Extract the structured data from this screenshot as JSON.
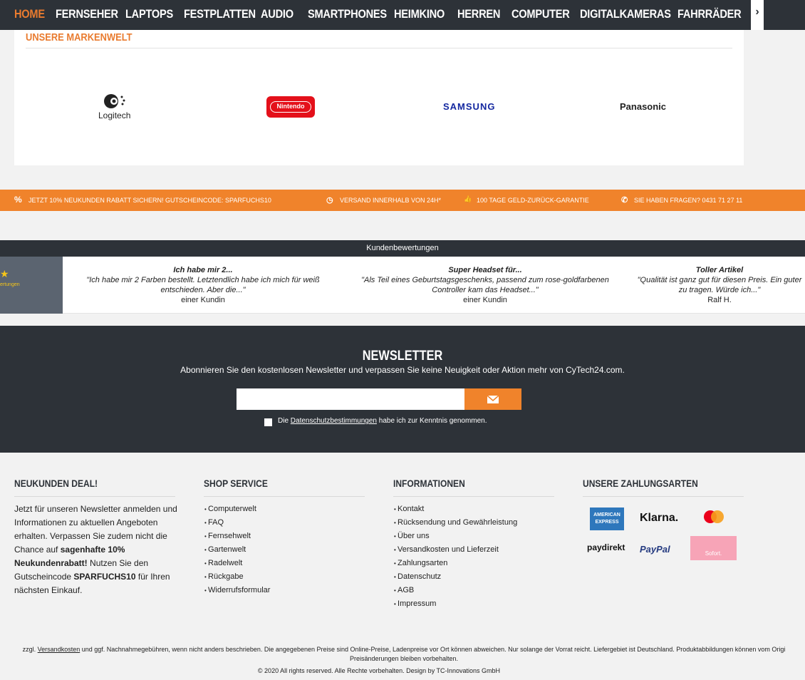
{
  "nav": {
    "items": [
      "HOME",
      "FERNSEHER",
      "LAPTOPS",
      "FESTPLATTEN",
      "AUDIO",
      "SMARTPHONES",
      "HEIMKINO",
      "HERREN",
      "COMPUTER",
      "DIGITALKAMERAS",
      "FAHRRÄDER"
    ],
    "active": "HOME",
    "arrow": "›"
  },
  "brands": {
    "title": "UNSERE MARKENWELT",
    "logitech": "Logitech",
    "nintendo": "Nintendo",
    "samsung": "SAMSUNG",
    "panasonic": "Panasonic"
  },
  "promo": {
    "rabatt": "JETZT 10% NEUKUNDEN RABATT SICHERN! GUTSCHEINCODE: SPARFUCHS10",
    "versand": "VERSAND INNERHALB VON 24H*",
    "garantie": "100 TAGE GELD-ZURÜCK-GARANTIE",
    "fragen": "SIE HABEN FRAGEN? 0431 71 27 11",
    "icon_percent": "%",
    "icon_clock": "◷",
    "icon_thumb": "👍",
    "icon_phone": "✆"
  },
  "reviews": {
    "header": "Kundenbewertungen",
    "badge_text": "ertungen",
    "items": [
      {
        "title": "Ich habe mir 2...",
        "text": "\"Ich habe mir 2 Farben bestellt. Letztendlich habe ich mich für weiß entschieden. Aber die...\"",
        "author": "einer Kundin"
      },
      {
        "title": "Super Headset für...",
        "text": "\"Als Teil eines Geburtstagsgeschenks, passend zum rose-goldfarbenen Controller kam das Headset...\"",
        "author": "einer Kundin"
      },
      {
        "title": "Toller Artikel",
        "text": "\"Qualität ist ganz gut für diesen Preis. Ein guter zu tragen. Würde ich...\"",
        "author": "Ralf H."
      }
    ]
  },
  "newsletter": {
    "title": "NEWSLETTER",
    "subtitle": "Abonnieren Sie den kostenlosen Newsletter und verpassen Sie keine Neuigkeit oder Aktion mehr von CyTech24.com.",
    "input_value": "",
    "consent_prefix": "Die",
    "consent_link": "Datenschutzbestimmungen",
    "consent_suffix": "habe ich zur Kenntnis genommen."
  },
  "footer": {
    "deal": {
      "title": "NEUKUNDEN DEAL!",
      "text_1": "Jetzt für unseren Newsletter anmelden und Informationen zu aktuellen Angeboten erhalten. Verpassen Sie zudem nicht die Chance auf ",
      "bold_1": "sagenhafte 10% Neukundenrabatt!",
      "text_2": " Nutzen Sie den Gutscheincode ",
      "bold_2": "SPARFUCHS10",
      "text_3": " für Ihren nächsten Einkauf."
    },
    "service": {
      "title": "SHOP SERVICE",
      "items": [
        "Computerwelt",
        "FAQ",
        "Fernsehwelt",
        "Gartenwelt",
        "Radelwelt",
        "Rückgabe",
        "Widerrufsformular"
      ]
    },
    "info": {
      "title": "INFORMATIONEN",
      "items": [
        "Kontakt",
        "Rücksendung und Gewährleistung",
        "Über uns",
        "Versandkosten und Lieferzeit",
        "Zahlungsarten",
        "Datenschutz",
        "AGB",
        "Impressum"
      ]
    },
    "payment": {
      "title": "UNSERE ZAHLUNGSARTEN",
      "amex": "AMERICAN EXPRESS",
      "klarna": "Klarna.",
      "mastercard": "mastercard",
      "paydirekt": "paydirekt",
      "paypal": "PayPal",
      "sofort": "Sofort."
    }
  },
  "legal": {
    "prefix": "zzgl.",
    "link": "Versandkosten",
    "text": "und ggf. Nachnahmegebühren, wenn nicht anders beschrieben. Die angegebenen Preise sind Online-Preise, Ladenpreise vor Ort können abweichen. Nur solange der Vorrat reicht. Liefergebiet ist Deutschland. Produktabbildungen können vom Origi",
    "text2": "Preisänderungen bleiben vorbehalten.",
    "copyright": "© 2020 All rights reserved. Alle Rechte vorbehalten. Design by TC-Innovations GmbH"
  },
  "colors": {
    "accent": "#f0832b",
    "dark": "#2d3238"
  }
}
